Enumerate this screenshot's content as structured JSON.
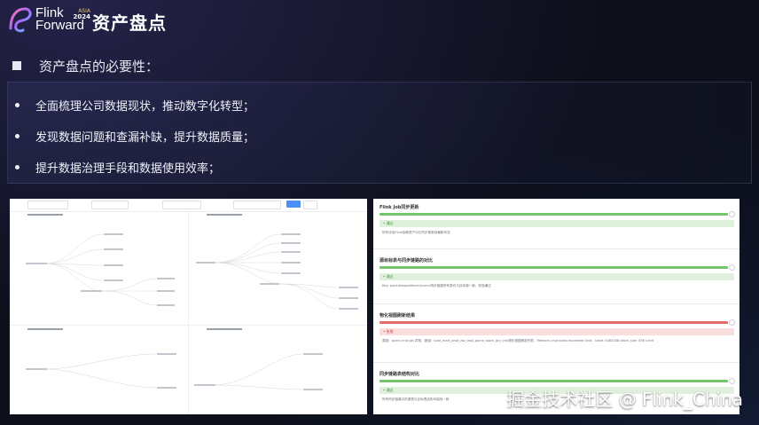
{
  "header": {
    "brand_line1": "Flink",
    "brand_line2": "Forward",
    "brand_region": "ASIA",
    "brand_year": "2024",
    "title": "资产盘点"
  },
  "section": {
    "heading": "资产盘点的必要性："
  },
  "bullets": [
    "全面梳理公司数据现状，推动数字化转型；",
    "发现数据问题和查漏补缺，提升数据质量；",
    "提升数据治理手段和数据使用效率；"
  ],
  "screenshot_right": {
    "checks": [
      {
        "title": "Flink Job同步更新",
        "status": "• 通过",
        "result": "ok",
        "desc": "所有涉及Flink依赖资产均已同步更新到最新状态"
      },
      {
        "title": "源目标表与同步链路的对比",
        "status": "• 通过",
        "result": "ok",
        "desc": "Key: prod-dataplatform/source同步链路所有表均与目标端一致，校验通过"
      },
      {
        "title": "物化视图刷新结果",
        "status": "• 失败",
        "result": "bad",
        "desc": "原因：query and job 异常，错误：load_mart_prod_dw_task_game_stock_qty_info物化视图刷新失败，Memory of process exceeded limit，Used: 4082408 block_size: 456 Limit"
      },
      {
        "title": "同步链路表结构对比",
        "status": "• 通过",
        "result": "ok",
        "desc": "所有同步链路中的源表与目标表结构均保持一致"
      }
    ]
  },
  "watermark": "掘金技术社区 @ Flink_China",
  "colors": {
    "background": "#0d0f1a",
    "pass_green": "#74c46e",
    "fail_red": "#e46b6b",
    "primary_button": "#4d8ef7"
  }
}
